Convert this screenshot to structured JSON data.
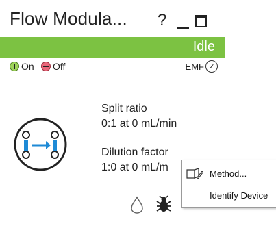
{
  "window": {
    "title": "Flow Modula...",
    "help_label": "?"
  },
  "status": {
    "text": "Idle",
    "color": "#7cc242"
  },
  "power": {
    "on_label": "On",
    "off_label": "Off",
    "emf_label": "EMF"
  },
  "info": {
    "split_ratio_label": "Split ratio",
    "split_ratio_value": "0:1 at 0 mL/min",
    "dilution_label": "Dilution factor",
    "dilution_value": "1:0 at 0 mL/m"
  },
  "context_menu": {
    "items": [
      {
        "label": "Method...",
        "icon": "method-icon"
      },
      {
        "label": "Identify Device"
      }
    ]
  },
  "colors": {
    "accent_blue": "#1e8ad6",
    "status_green": "#7cc242"
  }
}
